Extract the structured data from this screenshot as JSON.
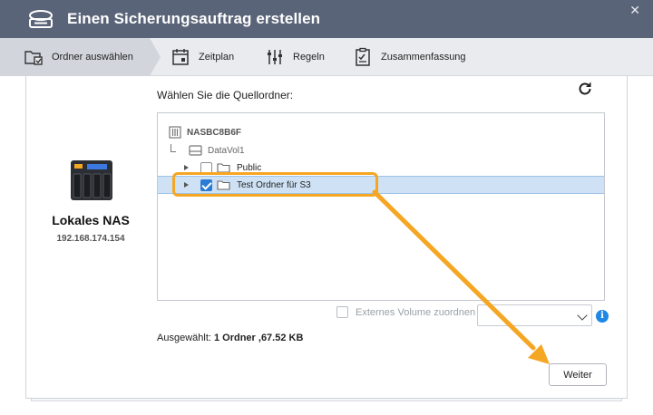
{
  "window": {
    "title": "Einen Sicherungsauftrag erstellen",
    "close_glyph": "✕"
  },
  "steps": [
    {
      "label": "Ordner auswählen",
      "icon": "folder-select-icon",
      "active": true
    },
    {
      "label": "Zeitplan",
      "icon": "calendar-icon",
      "active": false
    },
    {
      "label": "Regeln",
      "icon": "sliders-icon",
      "active": false
    },
    {
      "label": "Zusammenfassung",
      "icon": "clipboard-icon",
      "active": false
    }
  ],
  "source": {
    "device_name": "Lokales NAS",
    "device_ip": "192.168.174.154"
  },
  "folder_picker": {
    "label": "Wählen Sie die Quellordner:",
    "tree": {
      "root": "NASBC8B6F",
      "volume": "DataVol1",
      "folders": [
        {
          "name": "Public",
          "checked": false,
          "selected": false
        },
        {
          "name": "Test Ordner für S3",
          "checked": true,
          "selected": true
        }
      ]
    }
  },
  "external": {
    "label": "Externes Volume zuordnen",
    "checked": false,
    "select_value": "",
    "info_glyph": "i"
  },
  "summary": {
    "prefix": "Ausgewählt: ",
    "value": "1 Ordner ,67.52 KB"
  },
  "actions": {
    "next_label": "Weiter"
  },
  "colors": {
    "titlebar": "#5a6478",
    "accent": "#2a7bd4",
    "highlight": "#f5a623",
    "selected_row": "#cfe2f5"
  }
}
